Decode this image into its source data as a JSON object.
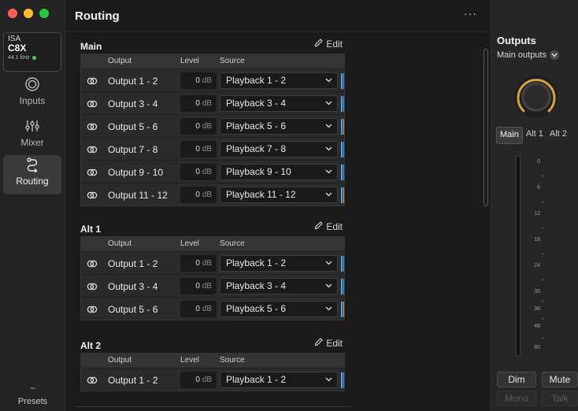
{
  "window": {
    "lights": {
      "close": "#ff5f57",
      "minimize": "#febc2e",
      "zoom": "#28c840"
    }
  },
  "device": {
    "brand": "ISA",
    "model": "C8X",
    "sample_rate": "44.1 kHz",
    "status_color": "#3fd15a"
  },
  "nav": {
    "inputs": "Inputs",
    "mixer": "Mixer",
    "routing": "Routing",
    "presets_glyph": "–",
    "presets": "Presets"
  },
  "header": {
    "title": "Routing",
    "more": "···"
  },
  "columns": {
    "output": "Output",
    "level": "Level",
    "source": "Source"
  },
  "edit_label": "Edit",
  "sections": [
    {
      "title": "Main",
      "rows": [
        {
          "output": "Output 1 - 2",
          "level": "0",
          "unit": "dB",
          "source": "Playback 1 - 2"
        },
        {
          "output": "Output 3 - 4",
          "level": "0",
          "unit": "dB",
          "source": "Playback 3 - 4"
        },
        {
          "output": "Output 5 - 6",
          "level": "0",
          "unit": "dB",
          "source": "Playback 5 - 6"
        },
        {
          "output": "Output 7 - 8",
          "level": "0",
          "unit": "dB",
          "source": "Playback 7 - 8"
        },
        {
          "output": "Output 9 - 10",
          "level": "0",
          "unit": "dB",
          "source": "Playback 9 - 10"
        },
        {
          "output": "Output 11 - 12",
          "level": "0",
          "unit": "dB",
          "source": "Playback 11 - 12"
        }
      ]
    },
    {
      "title": "Alt 1",
      "rows": [
        {
          "output": "Output 1 - 2",
          "level": "0",
          "unit": "dB",
          "source": "Playback 1 - 2"
        },
        {
          "output": "Output 3 - 4",
          "level": "0",
          "unit": "dB",
          "source": "Playback 3 - 4"
        },
        {
          "output": "Output 5 - 6",
          "level": "0",
          "unit": "dB",
          "source": "Playback 5 - 6"
        }
      ]
    },
    {
      "title": "Alt 2",
      "rows": [
        {
          "output": "Output 1 - 2",
          "level": "0",
          "unit": "dB",
          "source": "Playback 1 - 2"
        }
      ]
    }
  ],
  "outputs_panel": {
    "title": "Outputs",
    "selector": "Main outputs",
    "tabs": [
      "Main",
      "Alt 1",
      "Alt 2"
    ],
    "active_tab": "Main",
    "scale": [
      "0",
      "6",
      "12",
      "18",
      "24",
      "30",
      "36",
      "48",
      "60"
    ],
    "buttons": {
      "dim": "Dim",
      "mute": "Mute",
      "mono": "Mono",
      "talk": "Talk"
    },
    "knob_color": "#d8a23a"
  },
  "meter_colors": {
    "primary": "#4aa8ff",
    "secondary": "#e0a94a"
  }
}
